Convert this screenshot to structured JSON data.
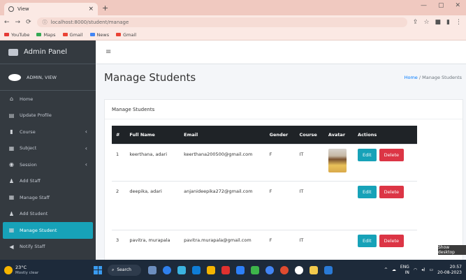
{
  "browser": {
    "tab_title": "View",
    "tab_close": "×",
    "new_tab": "+",
    "url": "localhost:8000/student/manage",
    "bookmarks": [
      {
        "label": "YouTube",
        "color": "#e53935"
      },
      {
        "label": "Maps",
        "color": "#34a853"
      },
      {
        "label": "Gmail",
        "color": "#ea4335"
      },
      {
        "label": "News",
        "color": "#4285f4"
      },
      {
        "label": "Gmail",
        "color": "#ea4335"
      }
    ]
  },
  "sidebar": {
    "brand": "Admin Panel",
    "user": "ADMIN, VIEW",
    "items": [
      {
        "label": "Home",
        "icon": "home-icon",
        "glyph": "⌂",
        "chevron": ""
      },
      {
        "label": "Update Profile",
        "icon": "profile-icon",
        "glyph": "▤",
        "chevron": ""
      },
      {
        "label": "Course",
        "icon": "bookmark-icon",
        "glyph": "▮",
        "chevron": "‹"
      },
      {
        "label": "Subject",
        "icon": "book-icon",
        "glyph": "▦",
        "chevron": "‹"
      },
      {
        "label": "Session",
        "icon": "clock-icon",
        "glyph": "◉",
        "chevron": "‹"
      },
      {
        "label": "Add Staff",
        "icon": "add-user-icon",
        "glyph": "♟",
        "chevron": ""
      },
      {
        "label": "Manage Staff",
        "icon": "grid-icon",
        "glyph": "▦",
        "chevron": ""
      },
      {
        "label": "Add Student",
        "icon": "add-user-icon",
        "glyph": "♟",
        "chevron": ""
      },
      {
        "label": "Manage Student",
        "icon": "table-icon",
        "glyph": "▦",
        "chevron": "",
        "active": true
      },
      {
        "label": "Notify Staff",
        "icon": "bullhorn-icon",
        "glyph": "◀",
        "chevron": ""
      }
    ]
  },
  "topnav": {
    "menu_glyph": "≡"
  },
  "page": {
    "title": "Manage Students",
    "breadcrumb_home": "Home",
    "breadcrumb_sep": " / ",
    "breadcrumb_current": "Manage Students",
    "card_title": "Manage Students"
  },
  "table": {
    "headers": [
      "#",
      "Full Name",
      "Email",
      "Gender",
      "Course",
      "Avatar",
      "Actions"
    ],
    "rows": [
      {
        "num": "1",
        "name": "keerthana, adari",
        "email": "keerthana200500@gmail.com",
        "gender": "F",
        "course": "IT",
        "has_avatar": true
      },
      {
        "num": "2",
        "name": "deepika, adari",
        "email": "anjanideepika272@gmail.com",
        "gender": "F",
        "course": "IT",
        "has_avatar": false
      },
      {
        "num": "3",
        "name": "pavitra, murapala",
        "email": "pavitra.murapala@gmail.com",
        "gender": "F",
        "course": "IT",
        "has_avatar": false
      }
    ],
    "edit_label": "Edit",
    "delete_label": "Delete"
  },
  "tooltip": "Show desktop",
  "taskbar": {
    "temp": "23°C",
    "weather": "Mostly clear",
    "search": "Search",
    "lang": "ENG",
    "lang_sub": "IN",
    "time": "20:57",
    "date": "20-08-2023"
  }
}
